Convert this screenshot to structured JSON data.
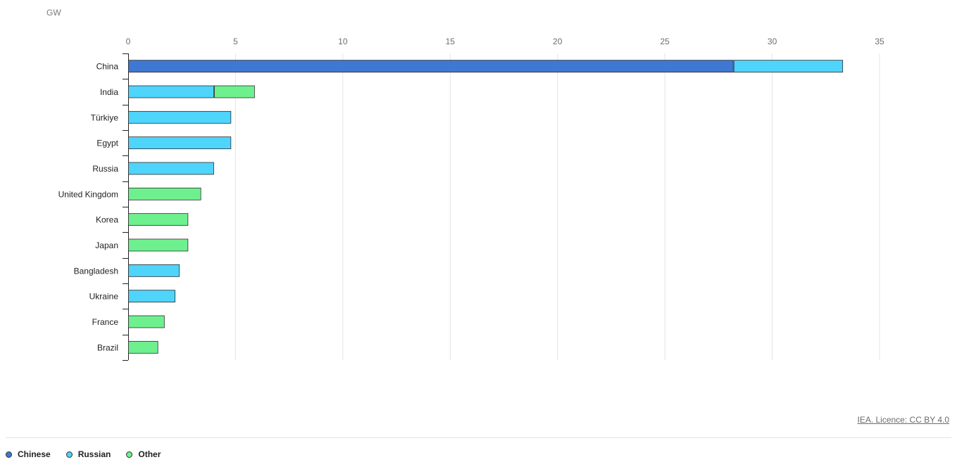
{
  "unit_label": "GW",
  "licence_text": "IEA. Licence: CC BY 4.0",
  "legend": [
    {
      "name": "Chinese",
      "color": "#3f78d2"
    },
    {
      "name": "Russian",
      "color": "#4fd4fb"
    },
    {
      "name": "Other",
      "color": "#6ef08f"
    }
  ],
  "chart_data": {
    "type": "bar",
    "orientation": "horizontal",
    "stacked": true,
    "categories": [
      "China",
      "India",
      "Türkiye",
      "Egypt",
      "Russia",
      "United Kingdom",
      "Korea",
      "Japan",
      "Bangladesh",
      "Ukraine",
      "France",
      "Brazil"
    ],
    "series": [
      {
        "name": "Chinese",
        "color": "#3f78d2",
        "values": [
          28.2,
          0,
          0,
          0,
          0,
          0,
          0,
          0,
          0,
          0,
          0,
          0
        ]
      },
      {
        "name": "Russian",
        "color": "#4fd4fb",
        "values": [
          5.1,
          4.0,
          4.8,
          4.8,
          4.0,
          0,
          0,
          0,
          2.4,
          2.2,
          0,
          0
        ]
      },
      {
        "name": "Other",
        "color": "#6ef08f",
        "values": [
          0,
          1.9,
          0,
          0,
          0,
          3.4,
          2.8,
          2.8,
          0,
          0,
          1.7,
          1.4
        ]
      }
    ],
    "xticks": [
      0,
      5,
      10,
      15,
      20,
      25,
      30,
      35
    ],
    "xlim": [
      0,
      35
    ],
    "ylabel": "GW",
    "grid": true,
    "legend_position": "bottom-left"
  }
}
